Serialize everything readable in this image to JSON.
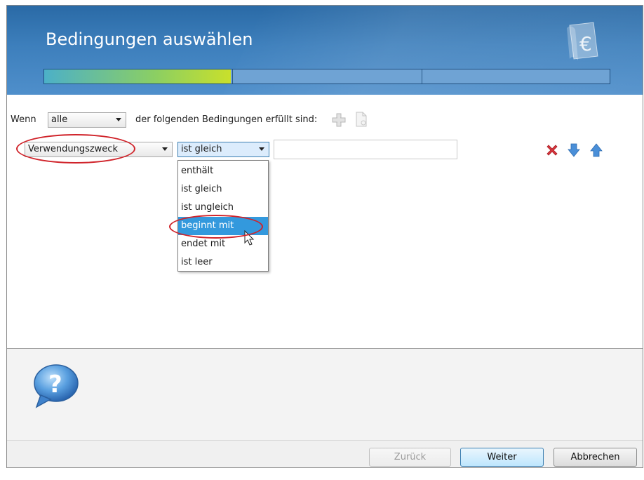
{
  "header": {
    "title": "Bedingungen auswählen",
    "progress": {
      "fraction": 0.33,
      "segments": 3
    }
  },
  "conditions": {
    "prefix_label": "Wenn",
    "match_select": {
      "value": "alle"
    },
    "suffix_label": "der folgenden Bedingungen erfüllt sind:",
    "add_icon": "plus-icon",
    "copy_icon": "document-icon",
    "rule": {
      "field_select": {
        "value": "Verwendungszweck"
      },
      "operator_select": {
        "value": "ist gleich"
      },
      "value_input": {
        "value": ""
      },
      "operator_options": [
        "enthält",
        "ist gleich",
        "ist ungleich",
        "beginnt mit",
        "endet mit",
        "ist leer"
      ],
      "highlighted_option": "beginnt mit",
      "actions": [
        "delete-icon",
        "arrow-down-icon",
        "arrow-up-icon"
      ]
    }
  },
  "help": {
    "icon": "help-question-icon"
  },
  "footer": {
    "back_label": "Zurück",
    "next_label": "Weiter",
    "cancel_label": "Abbrechen"
  },
  "colors": {
    "header_blue": "#3d7fbc",
    "progress_green": "#c9e02b",
    "highlight": "#3399dd",
    "annotation_red": "#d0232a",
    "delete_red": "#d8343c",
    "arrow_blue": "#4a8fd8"
  }
}
